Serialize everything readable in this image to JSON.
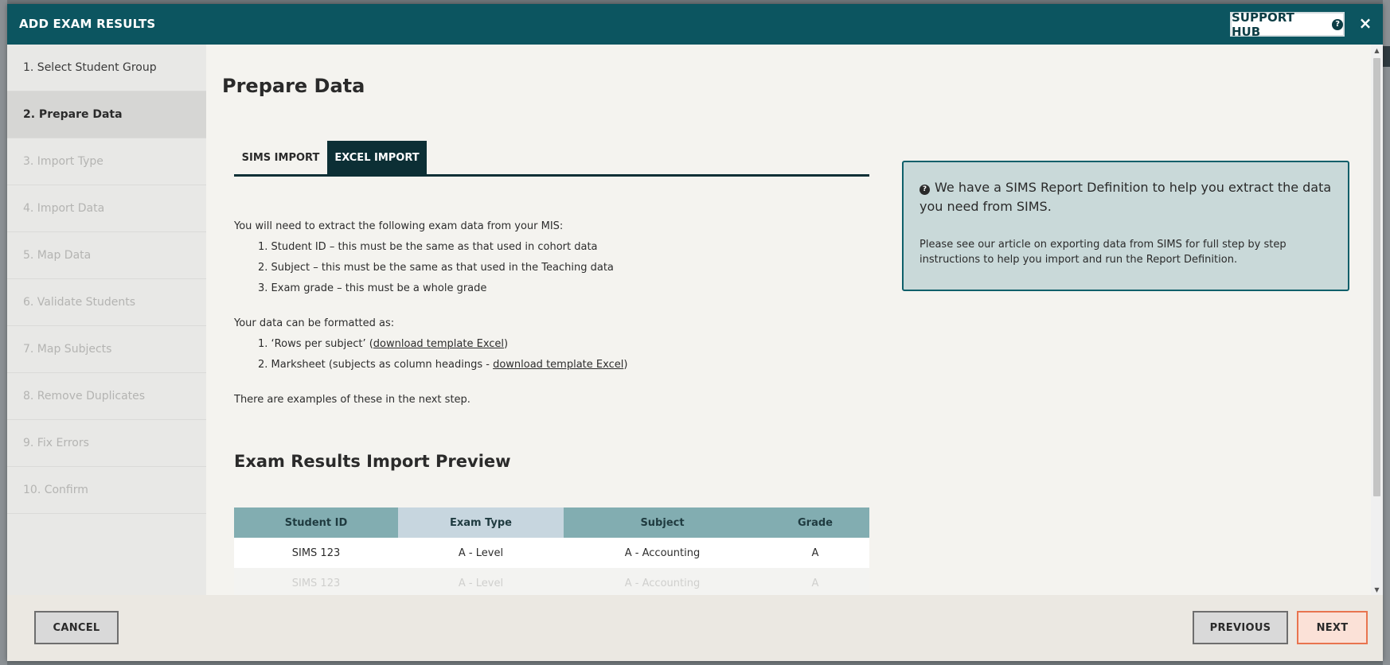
{
  "modal": {
    "title": "ADD EXAM RESULTS",
    "support_label": "SUPPORT HUB",
    "close_label": "×"
  },
  "sidebar": {
    "steps": [
      {
        "label": "1. Select Student Group",
        "state": "done"
      },
      {
        "label": "2. Prepare Data",
        "state": "active"
      },
      {
        "label": "3. Import Type",
        "state": "pending"
      },
      {
        "label": "4. Import Data",
        "state": "pending"
      },
      {
        "label": "5. Map Data",
        "state": "pending"
      },
      {
        "label": "6. Validate Students",
        "state": "pending"
      },
      {
        "label": "7. Map Subjects",
        "state": "pending"
      },
      {
        "label": "8. Remove Duplicates",
        "state": "pending"
      },
      {
        "label": "9. Fix Errors",
        "state": "pending"
      },
      {
        "label": "10. Confirm",
        "state": "pending"
      }
    ]
  },
  "main": {
    "title": "Prepare Data",
    "tabs": [
      {
        "label": "SIMS IMPORT",
        "active": false
      },
      {
        "label": "EXCEL IMPORT",
        "active": true
      }
    ],
    "intro": "You will need to extract the following exam data from your MIS:",
    "requirements": [
      "1. Student ID – this must be the same as that used in cohort data",
      "2. Subject – this must be the same as that used in the Teaching data",
      "3. Exam grade – this must be a whole grade"
    ],
    "format_intro": "Your data can be formatted as:",
    "formats": {
      "f1_prefix": "1. ‘Rows per subject’ (",
      "f1_link": "download template Excel",
      "f1_suffix": ")",
      "f2_prefix": "2. Marksheet (subjects as column headings - ",
      "f2_link": "download template Excel",
      "f2_suffix": ")"
    },
    "examples_note": "There are examples of these in the next step.",
    "preview_title": "Exam Results Import Preview",
    "table": {
      "headers": [
        "Student ID",
        "Exam Type",
        "Subject",
        "Grade"
      ],
      "rows": [
        [
          "SIMS 123",
          "A - Level",
          "A - Accounting",
          "A"
        ],
        [
          "SIMS 123",
          "A - Level",
          "A - Accounting",
          "A"
        ]
      ]
    }
  },
  "info_box": {
    "icon_glyph": "?",
    "headline": "We have a SIMS Report Definition to help you extract the data you need from SIMS.",
    "body": "Please see our article on exporting data from SIMS for full step by step instructions to help you import and run the Report Definition."
  },
  "footer": {
    "cancel_label": "CANCEL",
    "previous_label": "PREVIOUS",
    "next_label": "NEXT"
  },
  "colors": {
    "header_bg": "#0c5560",
    "tab_active_bg": "#0c2f35",
    "info_border": "#0d5f6a",
    "info_bg": "#c9d9d9",
    "next_border": "#e8744f"
  }
}
